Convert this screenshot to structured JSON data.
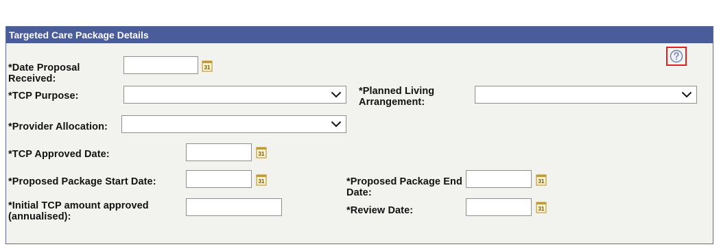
{
  "panel": {
    "title": "Targeted Care Package Details",
    "help_icon": "help-icon"
  },
  "fields": {
    "date_proposal_received": {
      "label": "*Date Proposal Received:",
      "value": ""
    },
    "tcp_purpose": {
      "label": "*TCP Purpose:",
      "value": ""
    },
    "planned_living_arrangement": {
      "label": "*Planned Living Arrangement:",
      "value": ""
    },
    "provider_allocation": {
      "label": "*Provider Allocation:",
      "value": ""
    },
    "tcp_approved_date": {
      "label": "*TCP Approved Date:",
      "value": ""
    },
    "proposed_package_start_date": {
      "label": "*Proposed Package Start Date:",
      "value": ""
    },
    "proposed_package_end_date": {
      "label": "*Proposed Package End Date:",
      "value": ""
    },
    "initial_tcp_amount": {
      "label": "*Initial TCP amount approved (annualised):",
      "value": ""
    },
    "review_date": {
      "label": "*Review Date:",
      "value": ""
    }
  },
  "colors": {
    "header_bg": "#4a5c99",
    "panel_bg": "#f2f2ef",
    "help_highlight": "#e01f1f"
  }
}
